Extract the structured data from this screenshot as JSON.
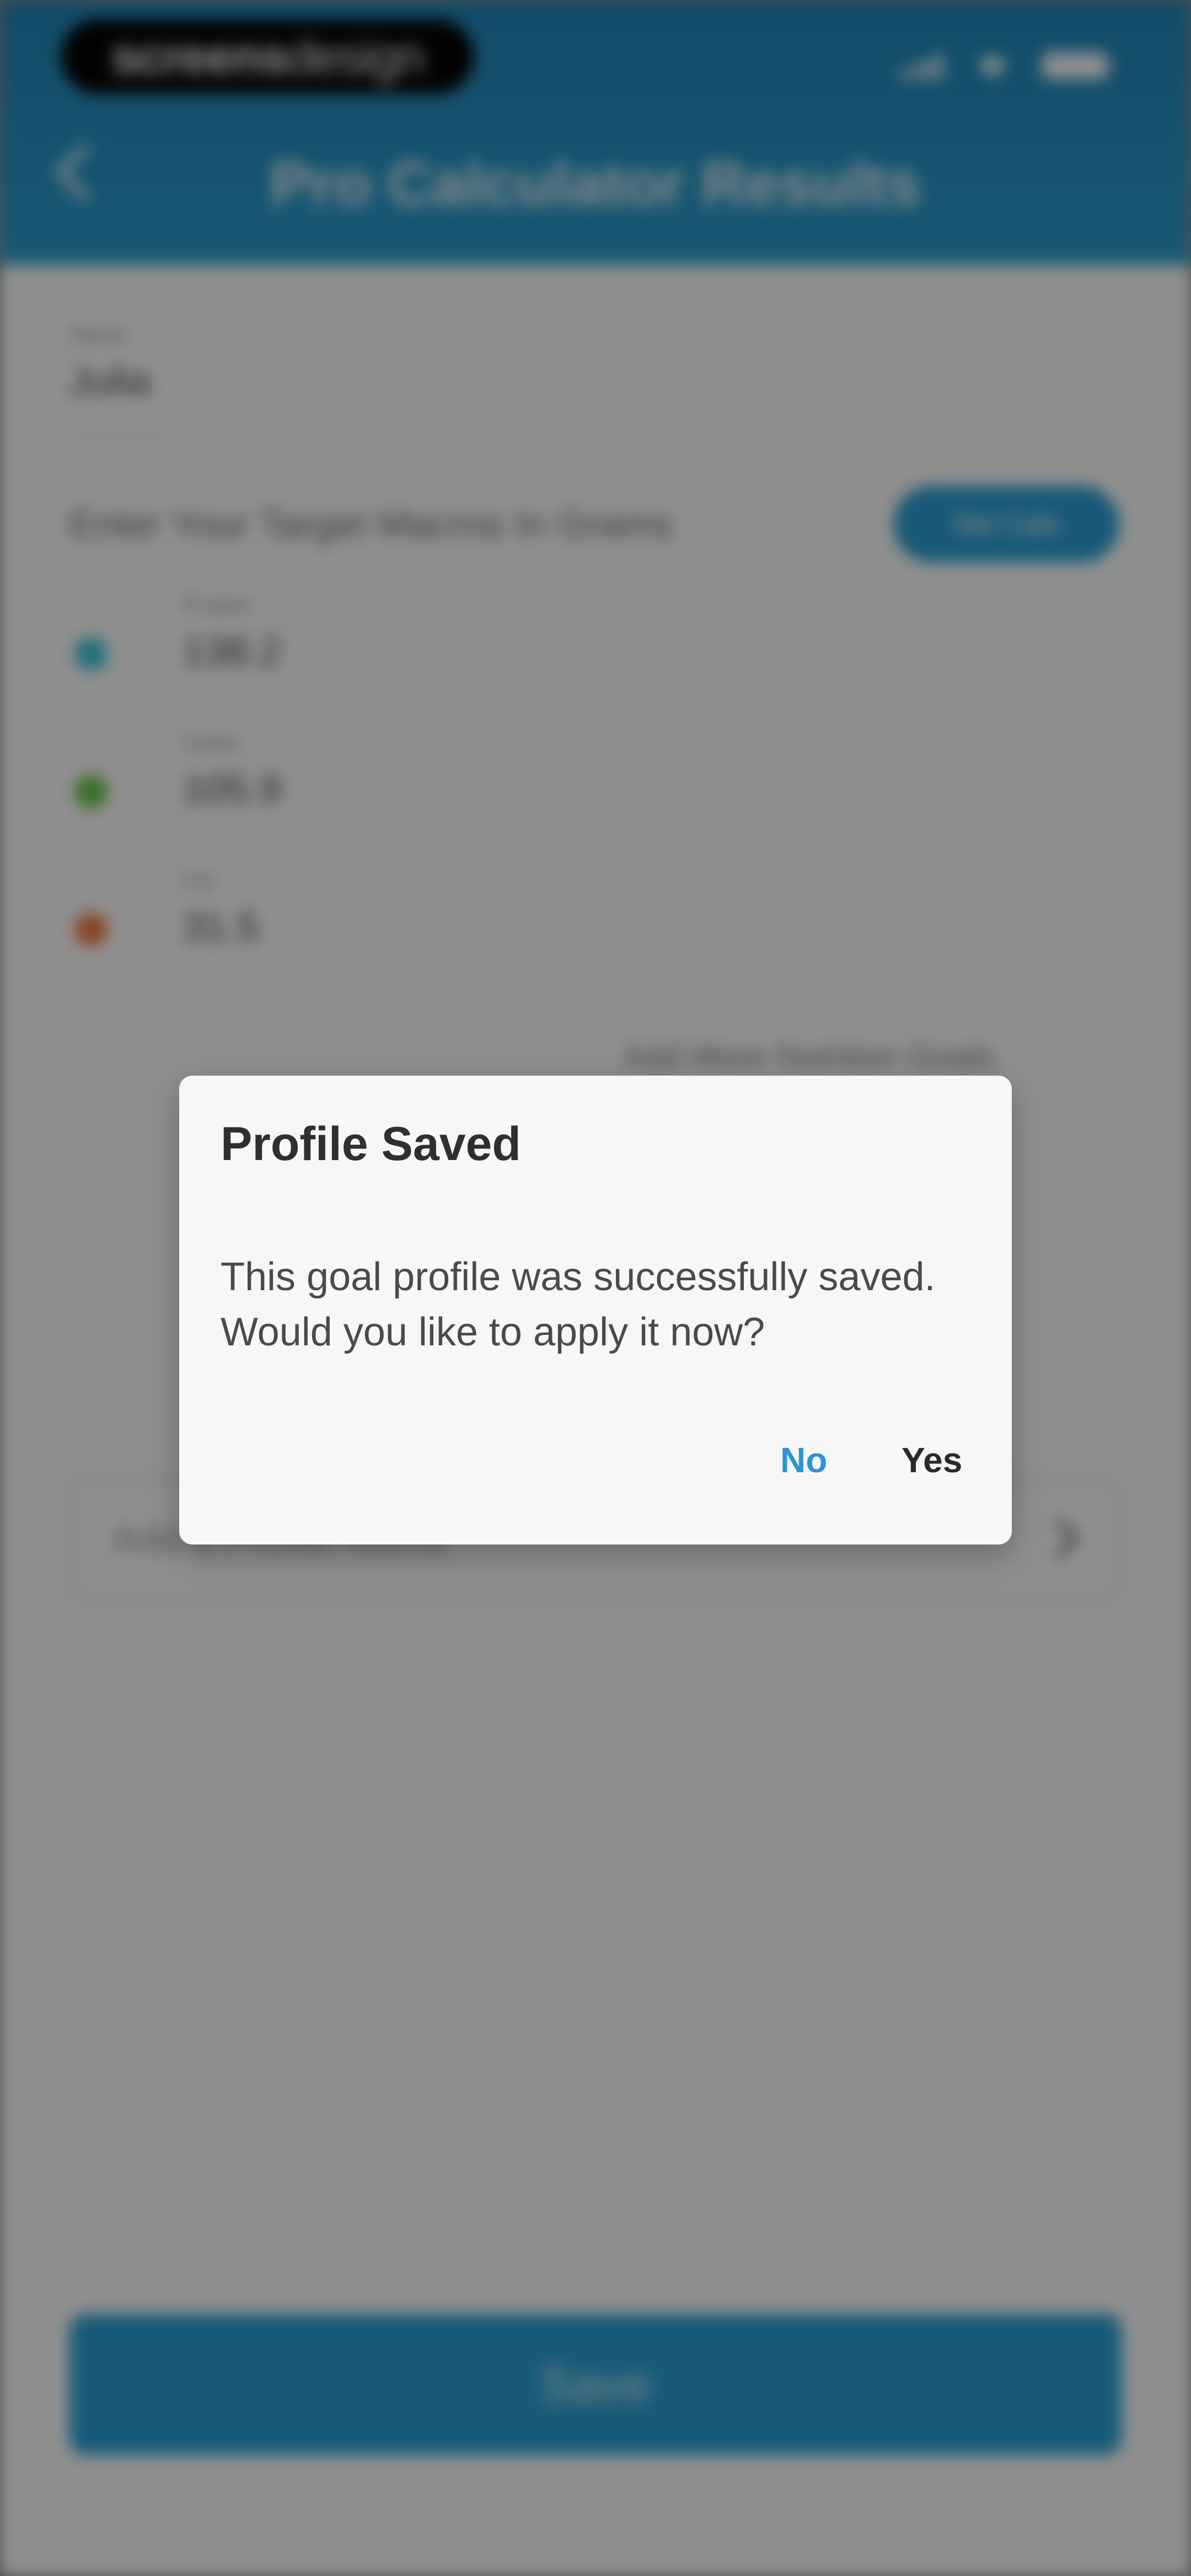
{
  "status_bar": {
    "brand_bold": "screens",
    "brand_regular": "design",
    "icons": [
      "signal-icon",
      "wifi-icon",
      "battery-icon"
    ]
  },
  "header": {
    "title": "Pro Calculator Results",
    "back_icon": "back-icon"
  },
  "profile_name": {
    "label": "Name",
    "value": "Julia"
  },
  "macros": {
    "section_label": "Enter Your Target Macros In Grams",
    "set_cals_label": "Set Cals",
    "items": [
      {
        "label": "Protein",
        "value": "138.2",
        "color": "#3ac6d8"
      },
      {
        "label": "Carbs",
        "value": "105.9",
        "color": "#62c43d"
      },
      {
        "label": "Fat",
        "value": "31.5",
        "color": "#ef7a3c"
      }
    ]
  },
  "add_more_link": "Add More Nutrition Goals",
  "notes": {
    "placeholder": "Add a Profile Name",
    "chevron_icon": "chevron-right-icon"
  },
  "save_button": "Save",
  "dialog": {
    "title": "Profile Saved",
    "message": "This goal profile was successfully saved. Would you like to apply it now?",
    "no_label": "No",
    "yes_label": "Yes"
  },
  "colors": {
    "header_accent": "#2da0cf",
    "dialog_no": "#2b94d6",
    "scrim": "rgba(0,0,0,0.44)"
  }
}
